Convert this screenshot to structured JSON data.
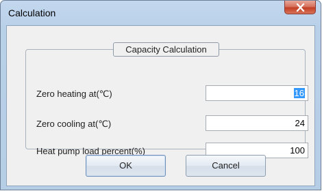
{
  "window": {
    "title": "Calculation"
  },
  "group": {
    "title": "Capacity Calculation"
  },
  "fields": [
    {
      "label": "Zero heating at(℃)",
      "value": "16"
    },
    {
      "label": "Zero cooling at(℃)",
      "value": "24"
    },
    {
      "label": "Heat pump load percent(%)",
      "value": "100"
    }
  ],
  "buttons": {
    "ok": "OK",
    "cancel": "Cancel"
  },
  "icons": {
    "close": "close-icon"
  }
}
